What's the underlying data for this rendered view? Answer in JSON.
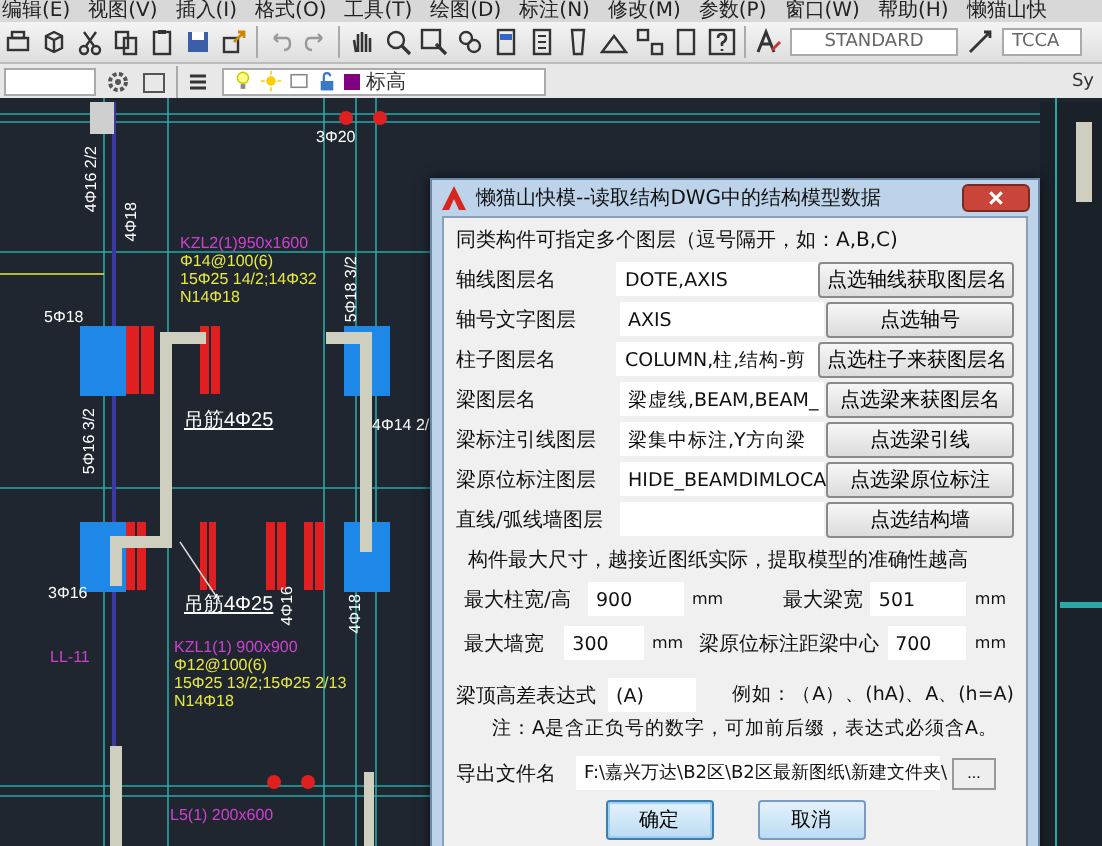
{
  "menu": [
    {
      "label": "编辑(E)"
    },
    {
      "label": "视图(V)"
    },
    {
      "label": "插入(I)"
    },
    {
      "label": "格式(O)"
    },
    {
      "label": "工具(T)"
    },
    {
      "label": "绘图(D)"
    },
    {
      "label": "标注(N)"
    },
    {
      "label": "修改(M)"
    },
    {
      "label": "参数(P)"
    },
    {
      "label": "窗口(W)"
    },
    {
      "label": "帮助(H)"
    },
    {
      "label": "懒猫山快"
    }
  ],
  "toolbar": {
    "text_style": "STANDARD",
    "dim_style": "TCCA"
  },
  "layer_bar": {
    "layer": "标高",
    "right_text": "Sy"
  },
  "drawing": {
    "labels": [
      {
        "text": "3Φ20",
        "color": "#ffffff"
      },
      {
        "text": "4Φ16 2/2",
        "color": "#ffffff"
      },
      {
        "text": "4Φ18",
        "color": "#ffffff"
      },
      {
        "text": "KZL2(1)950x1600",
        "color": "#d040d0"
      },
      {
        "text": "Φ14@100(6)",
        "color": "#e8e840"
      },
      {
        "text": "15Φ25 14/2;14Φ32",
        "color": "#e8e840"
      },
      {
        "text": "N14Φ18",
        "color": "#e8e840"
      },
      {
        "text": "5Φ18 3/2",
        "color": "#ffffff"
      },
      {
        "text": "5Φ18",
        "color": "#ffffff"
      },
      {
        "text": "5Φ16 3/2",
        "color": "#ffffff"
      },
      {
        "text": "吊筋4Φ25",
        "color": "#ffffff"
      },
      {
        "text": "4Φ14 2/",
        "color": "#ffffff"
      },
      {
        "text": "吊筋4Φ25",
        "color": "#ffffff"
      },
      {
        "text": "3Φ16",
        "color": "#ffffff"
      },
      {
        "text": "LL-11",
        "color": "#d040d0"
      },
      {
        "text": "KZL1(1) 900x900",
        "color": "#d040d0"
      },
      {
        "text": "Φ12@100(6)",
        "color": "#e8e840"
      },
      {
        "text": "15Φ25 13/2;15Φ25 2/13",
        "color": "#e8e840"
      },
      {
        "text": "N14Φ18",
        "color": "#e8e840"
      },
      {
        "text": "4Φ16",
        "color": "#ffffff"
      },
      {
        "text": "4Φ18",
        "color": "#ffffff"
      },
      {
        "text": "L5(1) 200x600",
        "color": "#d040d0"
      }
    ]
  },
  "dialog": {
    "title": "懒猫山快模--读取结构DWG中的结构模型数据",
    "hint": "同类构件可指定多个图层（逗号隔开，如：A,B,C)",
    "layer_rows": [
      {
        "label": "轴线图层名",
        "value": "DOTE,AXIS",
        "button": "点选轴线获取图层名"
      },
      {
        "label": "轴号文字图层",
        "value": "AXIS",
        "button": "点选轴号"
      },
      {
        "label": "柱子图层名",
        "value": "COLUMN,柱,结构-剪",
        "button": "点选柱子来获图层名"
      },
      {
        "label": "梁图层名",
        "value": "梁虚线,BEAM,BEAM_",
        "button": "点选梁来获图层名"
      },
      {
        "label": "梁标注引线图层",
        "value": "梁集中标注,Y方向梁",
        "button": "点选梁引线"
      },
      {
        "label": "梁原位标注图层",
        "value": "HIDE_BEAMDIMLOCA",
        "button": "点选梁原位标注"
      },
      {
        "label": "直线/弧线墙图层",
        "value": "",
        "button": "点选结构墙"
      }
    ],
    "size_note": "构件最大尺寸，越接近图纸实际，提取模型的准确性越高",
    "size_fields": [
      {
        "label": "最大柱宽/高",
        "value": "900",
        "unit": "mm"
      },
      {
        "label": "最大梁宽",
        "value": "501",
        "unit": "mm"
      },
      {
        "label": "最大墙宽",
        "value": "300",
        "unit": "mm"
      },
      {
        "label": "梁原位标注距梁中心",
        "value": "700",
        "unit": "mm"
      }
    ],
    "expression": {
      "label": "梁顶高差表达式",
      "value": "(A)",
      "example": "例如：（A）、(hA)、A、(h=A)"
    },
    "note": "注：A是含正负号的数字，可加前后缀，表达式必须含A。",
    "export": {
      "label": "导出文件名",
      "value": "F:\\嘉兴万达\\B2区\\B2区最新图纸\\新建文件夹\\",
      "browse": "..."
    },
    "buttons": [
      {
        "label": "确定",
        "default": true
      },
      {
        "label": "取消",
        "default": false
      }
    ]
  }
}
